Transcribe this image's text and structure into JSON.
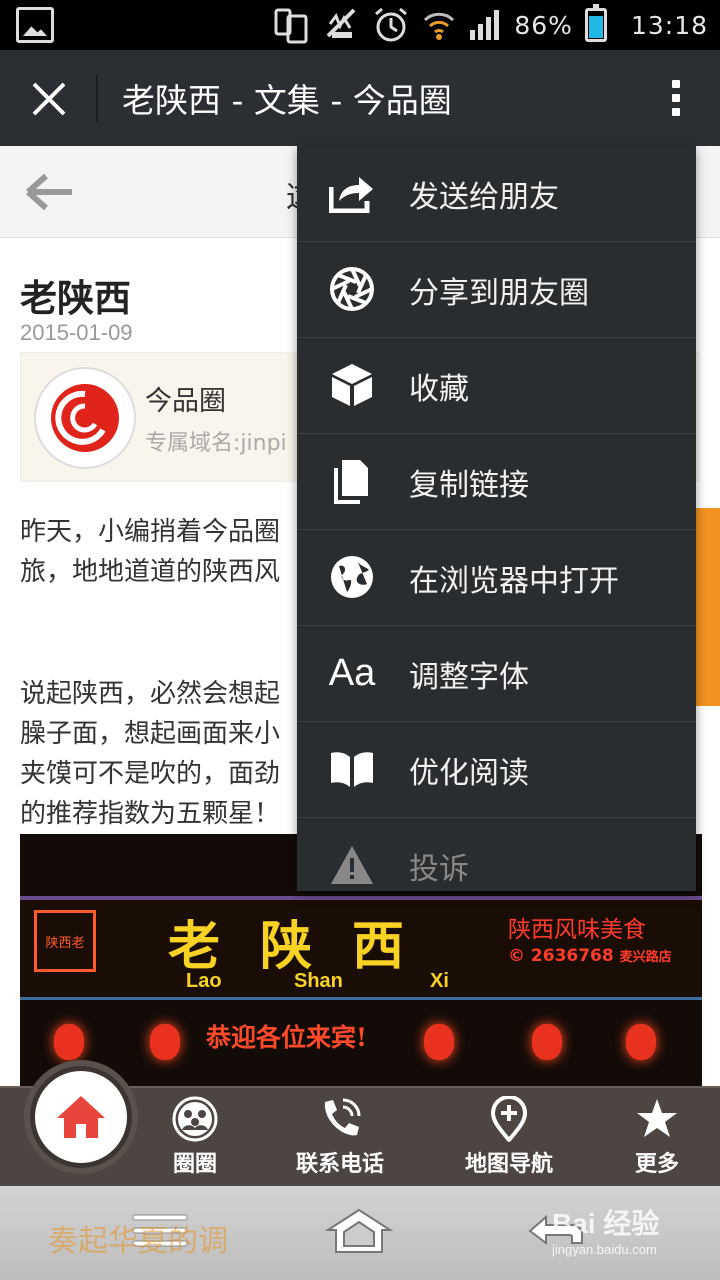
{
  "status_bar": {
    "battery": "86%",
    "time": "13:18"
  },
  "title_bar": {
    "title": "老陕西 - 文集 - 今品圈"
  },
  "page": {
    "nav_title_partial": "这",
    "article_title": "老陕西",
    "date": "2015-01-09",
    "card": {
      "name": "今品圈",
      "domain": "专属域名:jinpi"
    },
    "paragraph1": [
      "昨天，小编捎着今品圈",
      "旅，地地道道的陕西风"
    ],
    "paragraph2": [
      "说起陕西，必然会想起",
      "臊子面，想起画面来小",
      "夹馍可不是吹的，面劲",
      "的推荐指数为五颗星！"
    ],
    "photo": {
      "seal": "陕西老",
      "title": "老陕西",
      "pinyin": [
        "Lao",
        "Shan",
        "Xi"
      ],
      "side_text": "陕西风味美食",
      "phone": "© 2636768",
      "address": "麦兴路店",
      "welcome": "恭迎各位来宾!"
    }
  },
  "menu": {
    "items": [
      {
        "label": "发送给朋友",
        "icon": "share-forward-icon"
      },
      {
        "label": "分享到朋友圈",
        "icon": "aperture-icon"
      },
      {
        "label": "收藏",
        "icon": "cube-icon"
      },
      {
        "label": "复制链接",
        "icon": "copy-document-icon"
      },
      {
        "label": "在浏览器中打开",
        "icon": "globe-icon"
      },
      {
        "label": "调整字体",
        "icon": "font-size-icon",
        "glyph": "Aa"
      },
      {
        "label": "优化阅读",
        "icon": "book-icon"
      },
      {
        "label": "投诉",
        "icon": "warning-icon"
      }
    ]
  },
  "toolbar": {
    "items": [
      {
        "label": "圈圈",
        "icon": "people-circle-icon"
      },
      {
        "label": "联系电话",
        "icon": "phone-icon"
      },
      {
        "label": "地图导航",
        "icon": "map-pin-icon"
      },
      {
        "label": "更多",
        "icon": "star-icon"
      }
    ]
  },
  "nav_bar": {
    "overlay_text": "奏起华夏的调",
    "watermark": "Bai 经验",
    "watermark_url": "jingyan.baidu.com"
  },
  "colors": {
    "titlebar": "#2b2f33",
    "menu_bg": "#2a2d30",
    "toolbar_bg": "#4d4541",
    "accent_orange": "#f39221",
    "home_red": "#e8453c"
  }
}
